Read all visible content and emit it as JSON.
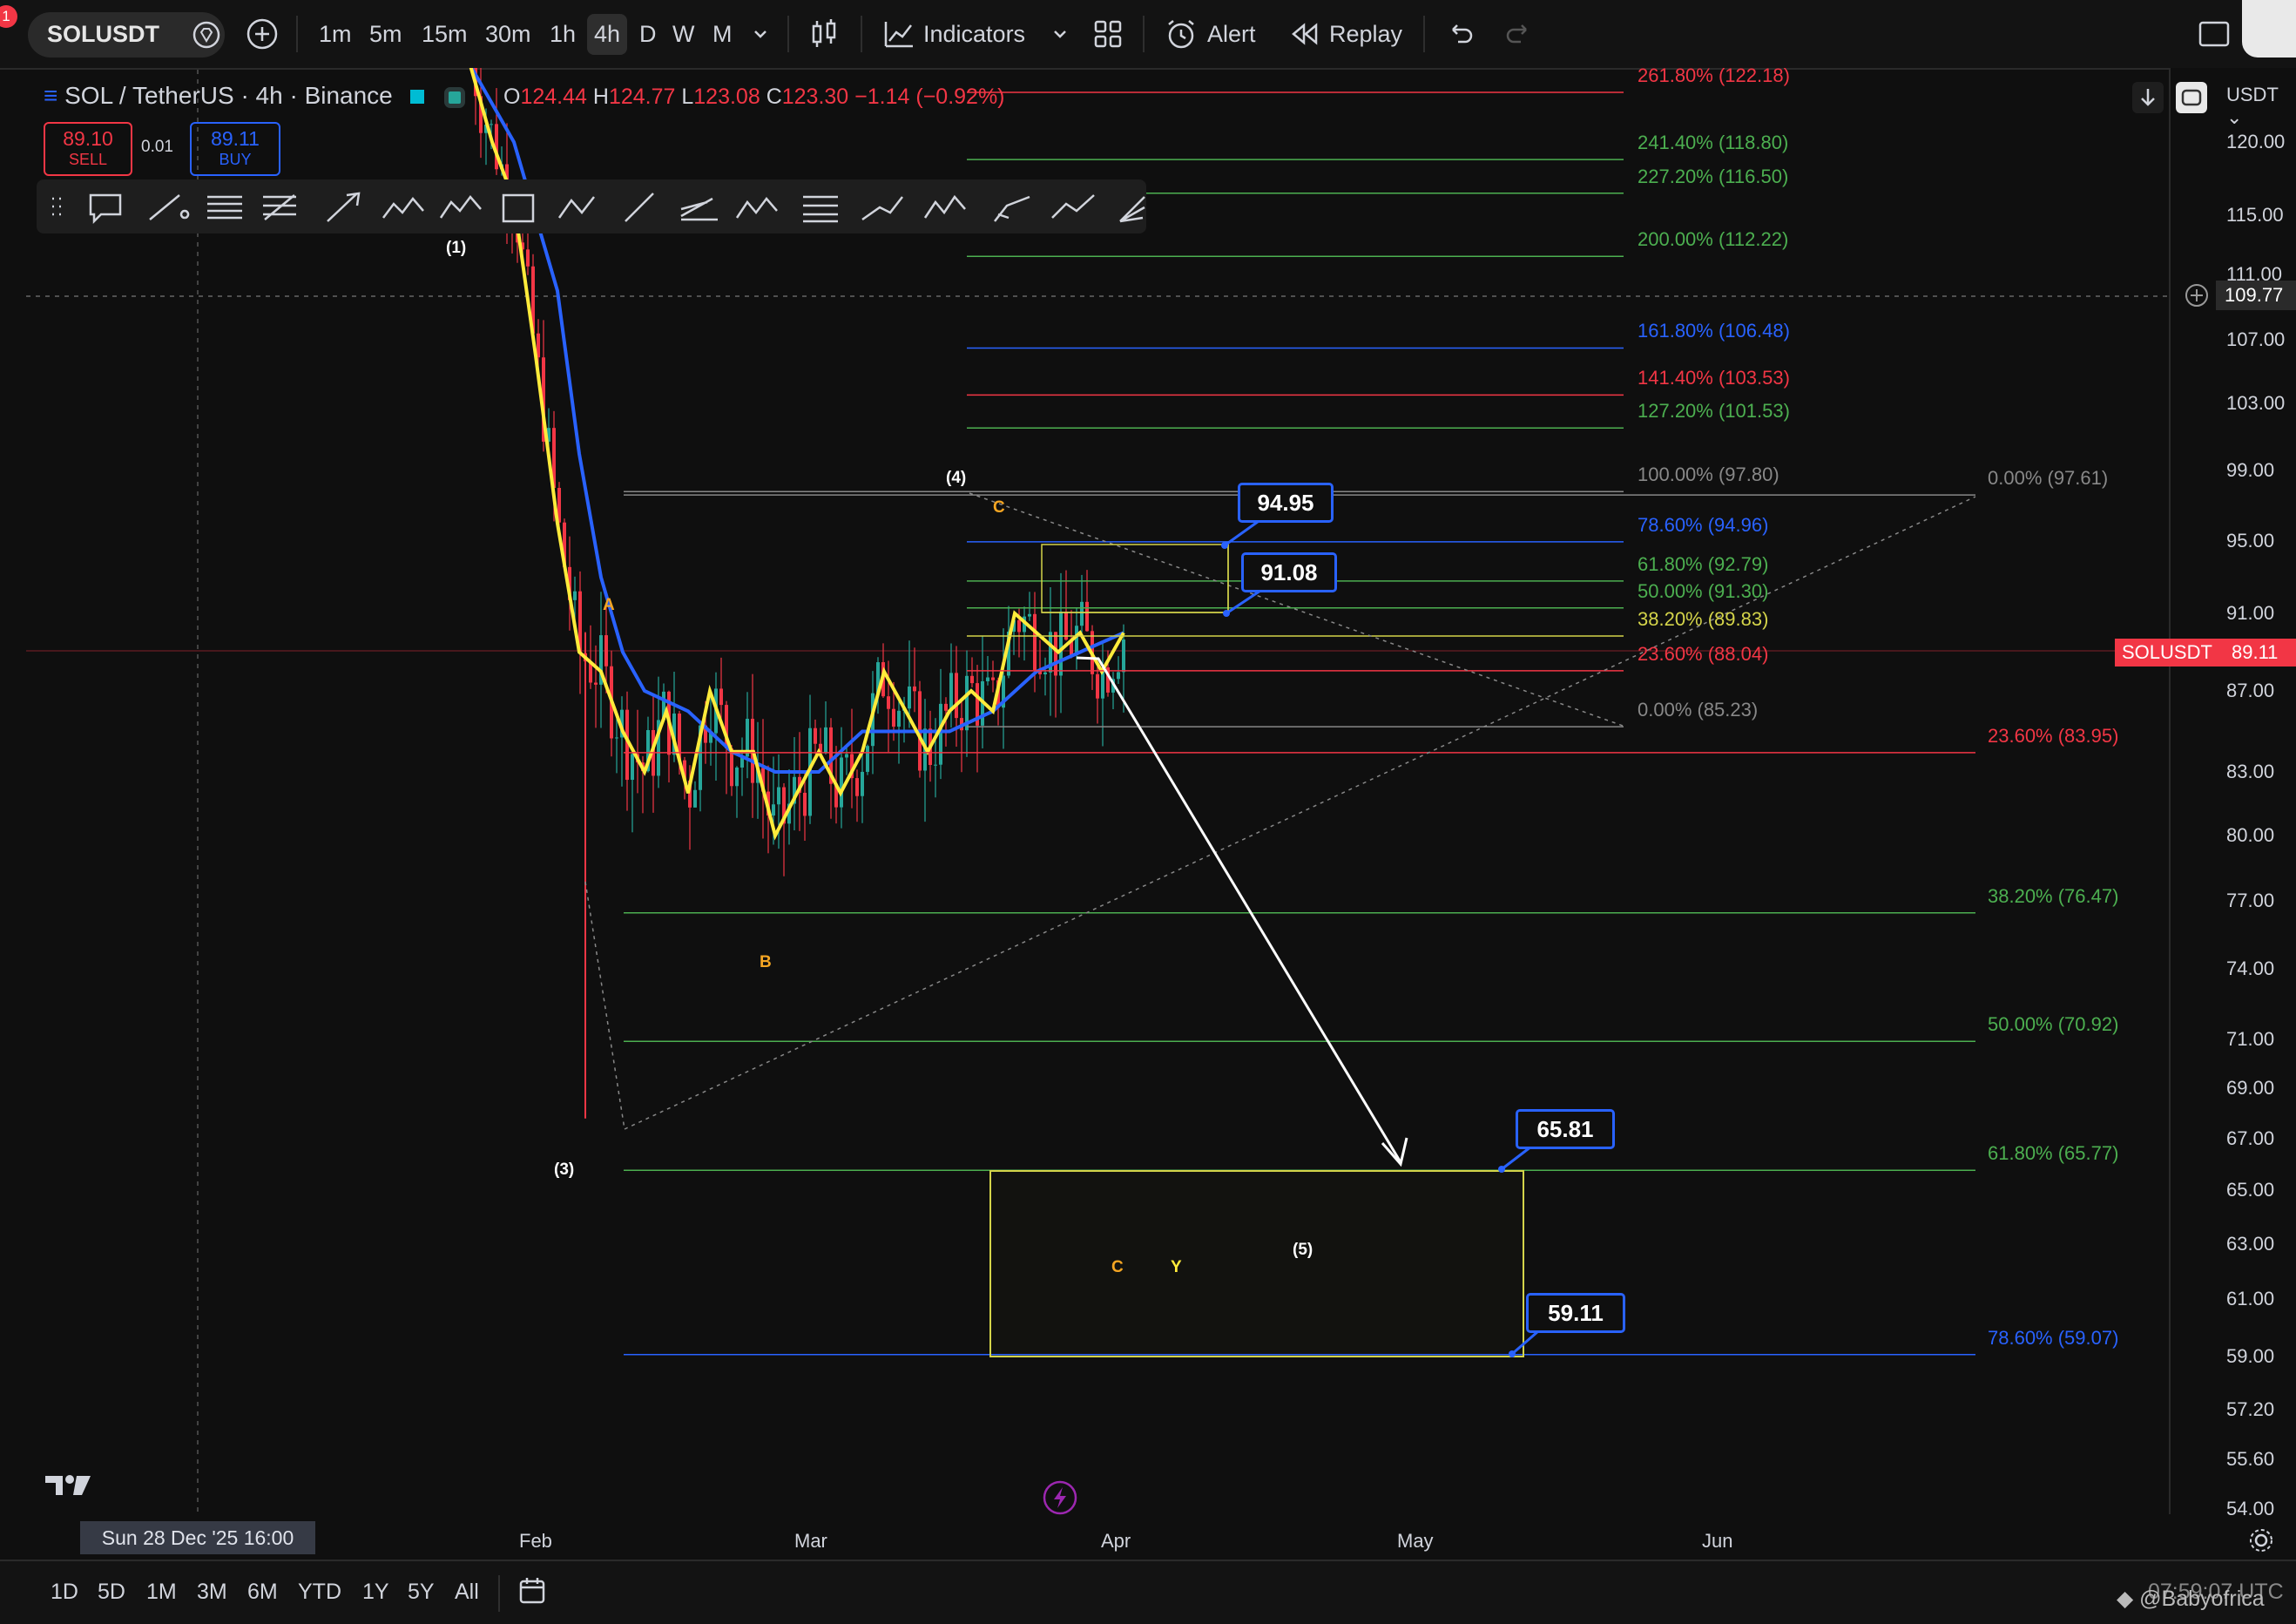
{
  "toolbar": {
    "notification_count": "1",
    "symbol": "SOLUSDT",
    "timeframes": [
      "1m",
      "5m",
      "15m",
      "30m",
      "1h",
      "4h",
      "D",
      "W",
      "M"
    ],
    "active_timeframe": "4h",
    "indicators_label": "Indicators",
    "alert_label": "Alert",
    "replay_label": "Replay"
  },
  "legend": {
    "title": "SOL / TetherUS · 4h · Binance",
    "open_label": "O",
    "open": "124.44",
    "high_label": "H",
    "high": "124.77",
    "low_label": "L",
    "low": "123.08",
    "close_label": "C",
    "close": "123.30",
    "change": "−1.14 (−0.92%)"
  },
  "trade": {
    "sell_price": "89.10",
    "sell_label": "SELL",
    "spread": "0.01",
    "buy_price": "89.11",
    "buy_label": "BUY"
  },
  "price_axis": {
    "currency": "USDT",
    "crosshair_price": "109.77",
    "symbol_tag": "SOLUSDT",
    "last_price": "89.11",
    "ticks": [
      "120.00",
      "115.00",
      "111.00",
      "107.00",
      "103.00",
      "99.00",
      "95.00",
      "91.00",
      "87.00",
      "83.00",
      "80.00",
      "77.00",
      "74.00",
      "71.00",
      "69.00",
      "67.00",
      "65.00",
      "63.00",
      "61.00",
      "59.00",
      "57.20",
      "55.60",
      "54.00"
    ]
  },
  "time_axis": {
    "crosshair_label": "Sun 28 Dec '25   16:00",
    "ticks": [
      "Feb",
      "Mar",
      "Apr",
      "May",
      "Jun"
    ]
  },
  "bottom_bar": {
    "ranges": [
      "1D",
      "5D",
      "1M",
      "3M",
      "6M",
      "YTD",
      "1Y",
      "5Y",
      "All"
    ],
    "clock": "07:59:07 UTC",
    "watermark": "@Babyofrica"
  },
  "colors": {
    "background": "#0f0f0f",
    "up_candle": "#26a69a",
    "down_candle": "#f23645",
    "ma_fast": "#ffeb3b",
    "ma_slow": "#2962ff",
    "fib_red": "#f23645",
    "fib_green": "#4caf50",
    "fib_blue": "#2962ff",
    "fib_gray": "#888888",
    "zone": "#d4d44a"
  },
  "chart_data": {
    "type": "candlestick",
    "symbol": "SOL / TetherUS",
    "interval": "4h",
    "exchange": "Binance",
    "ylim": [
      53,
      124
    ],
    "x_ticks": [
      "Feb",
      "Mar",
      "Apr",
      "May",
      "Jun"
    ],
    "ma_fast_path": [
      [
        0.0,
        124
      ],
      [
        0.5,
        120
      ],
      [
        1.0,
        116
      ],
      [
        1.5,
        106
      ],
      [
        2.0,
        96
      ],
      [
        2.5,
        89
      ],
      [
        3.0,
        88
      ],
      [
        3.5,
        85
      ],
      [
        4.0,
        83
      ],
      [
        4.5,
        86
      ],
      [
        5.0,
        82
      ],
      [
        5.5,
        87
      ],
      [
        6.0,
        84
      ],
      [
        6.5,
        84
      ],
      [
        7.0,
        80
      ],
      [
        7.5,
        82
      ],
      [
        8.0,
        84
      ],
      [
        8.5,
        82
      ],
      [
        9.0,
        84
      ],
      [
        9.5,
        88
      ],
      [
        10.0,
        86
      ],
      [
        10.5,
        84
      ],
      [
        11.0,
        86
      ],
      [
        11.5,
        87
      ],
      [
        12.0,
        86
      ],
      [
        12.5,
        91
      ],
      [
        13.0,
        90
      ],
      [
        13.5,
        89
      ],
      [
        14.0,
        90
      ],
      [
        14.5,
        88
      ],
      [
        15.0,
        90
      ]
    ],
    "ma_slow_path": [
      [
        0.0,
        124
      ],
      [
        1.0,
        120
      ],
      [
        2.0,
        110
      ],
      [
        2.5,
        100
      ],
      [
        3.0,
        93
      ],
      [
        3.5,
        89
      ],
      [
        4.0,
        87
      ],
      [
        5.0,
        86
      ],
      [
        6.0,
        84
      ],
      [
        7.0,
        83
      ],
      [
        8.0,
        83
      ],
      [
        9.0,
        85
      ],
      [
        10.0,
        85
      ],
      [
        11.0,
        85
      ],
      [
        12.0,
        86
      ],
      [
        13.0,
        88
      ],
      [
        14.0,
        89
      ],
      [
        15.0,
        90
      ]
    ],
    "fib_extension_levels": [
      {
        "label": "261.80% (122.18)",
        "value": 122.18,
        "color": "#f23645"
      },
      {
        "label": "241.40% (118.80)",
        "value": 118.8,
        "color": "#4caf50"
      },
      {
        "label": "227.20% (116.50)",
        "value": 116.5,
        "color": "#4caf50"
      },
      {
        "label": "200.00% (112.22)",
        "value": 112.22,
        "color": "#4caf50"
      },
      {
        "label": "161.80% (106.48)",
        "value": 106.48,
        "color": "#2962ff"
      },
      {
        "label": "141.40% (103.53)",
        "value": 103.53,
        "color": "#f23645"
      },
      {
        "label": "127.20% (101.53)",
        "value": 101.53,
        "color": "#4caf50"
      },
      {
        "label": "100.00% (97.80)",
        "value": 97.8,
        "color": "#888888"
      },
      {
        "label": "78.60% (94.96)",
        "value": 94.96,
        "color": "#2962ff"
      },
      {
        "label": "61.80% (92.79)",
        "value": 92.79,
        "color": "#4caf50"
      },
      {
        "label": "50.00% (91.30)",
        "value": 91.3,
        "color": "#4caf50"
      },
      {
        "label": "38.20% (89.83)",
        "value": 89.83,
        "color": "#d4d44a"
      },
      {
        "label": "23.60% (88.04)",
        "value": 88.04,
        "color": "#f23645"
      },
      {
        "label": "0.00% (85.23)",
        "value": 85.23,
        "color": "#888888"
      }
    ],
    "fib_retracement_levels": [
      {
        "label": "0.00% (97.61)",
        "value": 97.61,
        "color": "#888888"
      },
      {
        "label": "23.60% (83.95)",
        "value": 83.95,
        "color": "#f23645"
      },
      {
        "label": "38.20% (76.47)",
        "value": 76.47,
        "color": "#4caf50"
      },
      {
        "label": "50.00% (70.92)",
        "value": 70.92,
        "color": "#4caf50"
      },
      {
        "label": "61.80% (65.77)",
        "value": 65.77,
        "color": "#4caf50"
      },
      {
        "label": "78.60% (59.07)",
        "value": 59.07,
        "color": "#2962ff"
      }
    ],
    "callouts": [
      {
        "text": "94.95",
        "value": 94.95
      },
      {
        "text": "91.08",
        "value": 91.08
      },
      {
        "text": "65.81",
        "value": 65.81
      },
      {
        "text": "59.11",
        "value": 59.11
      }
    ],
    "wave_labels": [
      {
        "text": "(1)",
        "color": "#ffffff"
      },
      {
        "text": "(3)",
        "color": "#ffffff"
      },
      {
        "text": "(4)",
        "color": "#ffffff"
      },
      {
        "text": "(5)",
        "color": "#ffffff"
      },
      {
        "text": "A",
        "color": "#f5a623"
      },
      {
        "text": "B",
        "color": "#f5a623"
      },
      {
        "text": "C",
        "color": "#f5a623"
      },
      {
        "text": "C",
        "color": "#f5a623"
      },
      {
        "text": "Y",
        "color": "#ffeb3b"
      }
    ],
    "target_zone": {
      "top": 65.81,
      "bottom": 59.11
    }
  }
}
